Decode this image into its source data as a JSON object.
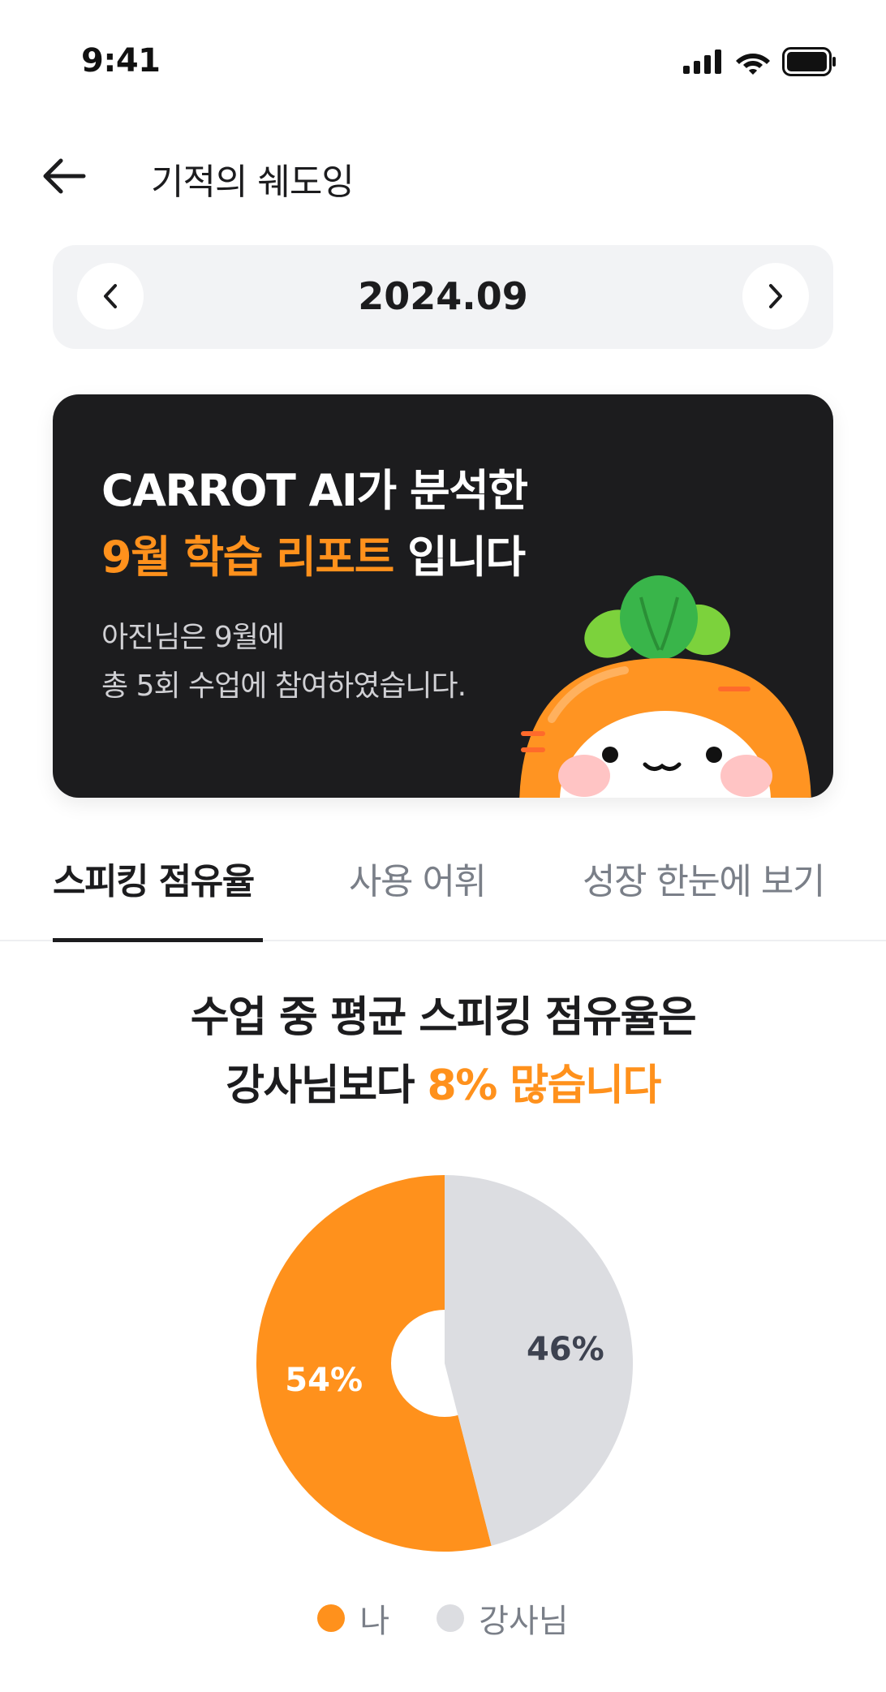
{
  "status_bar": {
    "time": "9:41"
  },
  "header": {
    "title": "기적의 쉐도잉"
  },
  "month_nav": {
    "label": "2024.09"
  },
  "report_card": {
    "line1": "CARROT AI가 분석한",
    "line2_accent": "9월 학습 리포트",
    "line2_rest": " 입니다",
    "sub1": "아진님은 9월에",
    "sub2": "총 5회 수업에 참여하였습니다."
  },
  "tabs": [
    {
      "label": "스피킹 점유율",
      "active": true
    },
    {
      "label": "사용 어휘",
      "active": false
    },
    {
      "label": "성장 한눈에 보기",
      "active": false
    }
  ],
  "summary": {
    "line1": "수업 중 평균 스피킹 점유율은",
    "line2_prefix": "강사님보다 ",
    "line2_accent": "8% 많습니다"
  },
  "colors": {
    "accent": "#ff911c",
    "secondary": "#dcdde1",
    "dark": "#1c1c1e"
  },
  "chart_data": {
    "type": "pie",
    "categories": [
      "나",
      "강사님"
    ],
    "values": [
      54,
      46
    ],
    "value_labels": [
      "54%",
      "46%"
    ],
    "colors": [
      "#ff911c",
      "#dcdde1"
    ],
    "donut": true,
    "legend_position": "bottom"
  }
}
